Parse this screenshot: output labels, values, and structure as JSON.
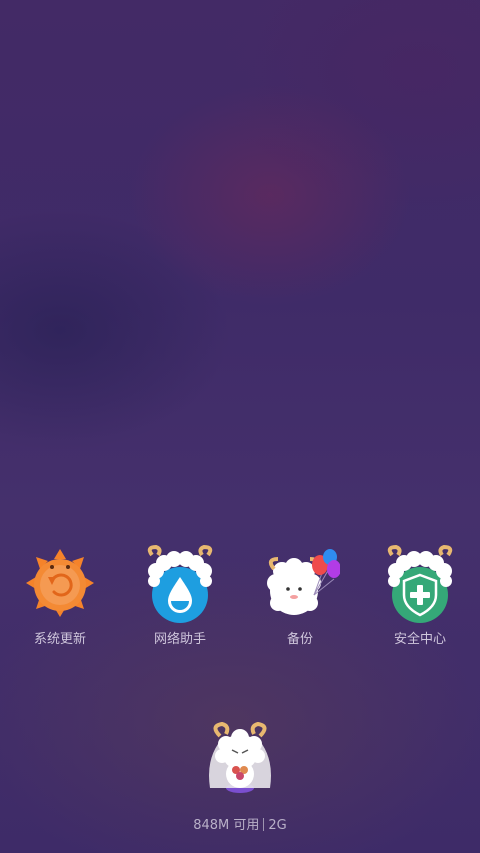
{
  "apps": [
    {
      "label": "系统更新",
      "icon": "system-update-icon",
      "color": "#f5832a"
    },
    {
      "label": "网络助手",
      "icon": "network-assistant-icon",
      "color": "#1e9ee0"
    },
    {
      "label": "备份",
      "icon": "backup-icon",
      "color": "#ffffff"
    },
    {
      "label": "安全中心",
      "icon": "security-center-icon",
      "color": "#35a878"
    }
  ],
  "memory": {
    "available": "848M 可用",
    "total": "2G"
  }
}
